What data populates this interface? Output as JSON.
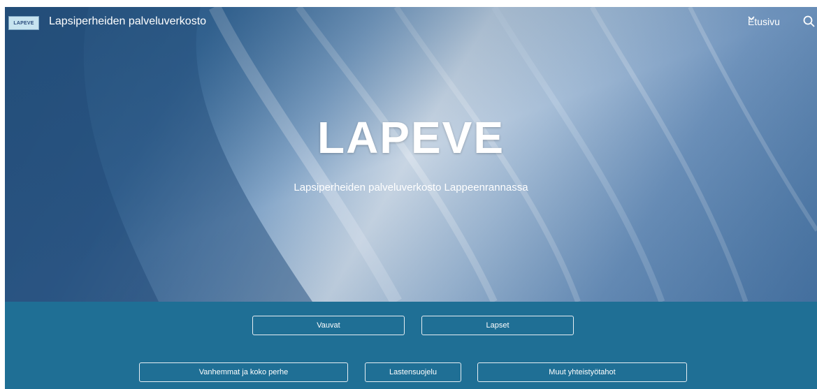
{
  "header": {
    "logo_text": "LAPEVE",
    "site_title": "Lapsiperheiden palveluverkosto",
    "nav_home": "Etusivu",
    "icons": {
      "dropdown": "chevron-down-icon",
      "search": "search-icon"
    }
  },
  "hero": {
    "title": "LAPEVE",
    "subtitle": "Lapsiperheiden palveluverkosto Lappeenrannassa"
  },
  "buttons": {
    "row1": [
      "Vauvat",
      "Lapset"
    ],
    "row2": [
      "Vanhemmat ja koko perhe",
      "Lastensuojelu",
      "Muut yhteistyötahot"
    ]
  },
  "colors": {
    "band": "#1f6f95",
    "text": "#ffffff"
  }
}
